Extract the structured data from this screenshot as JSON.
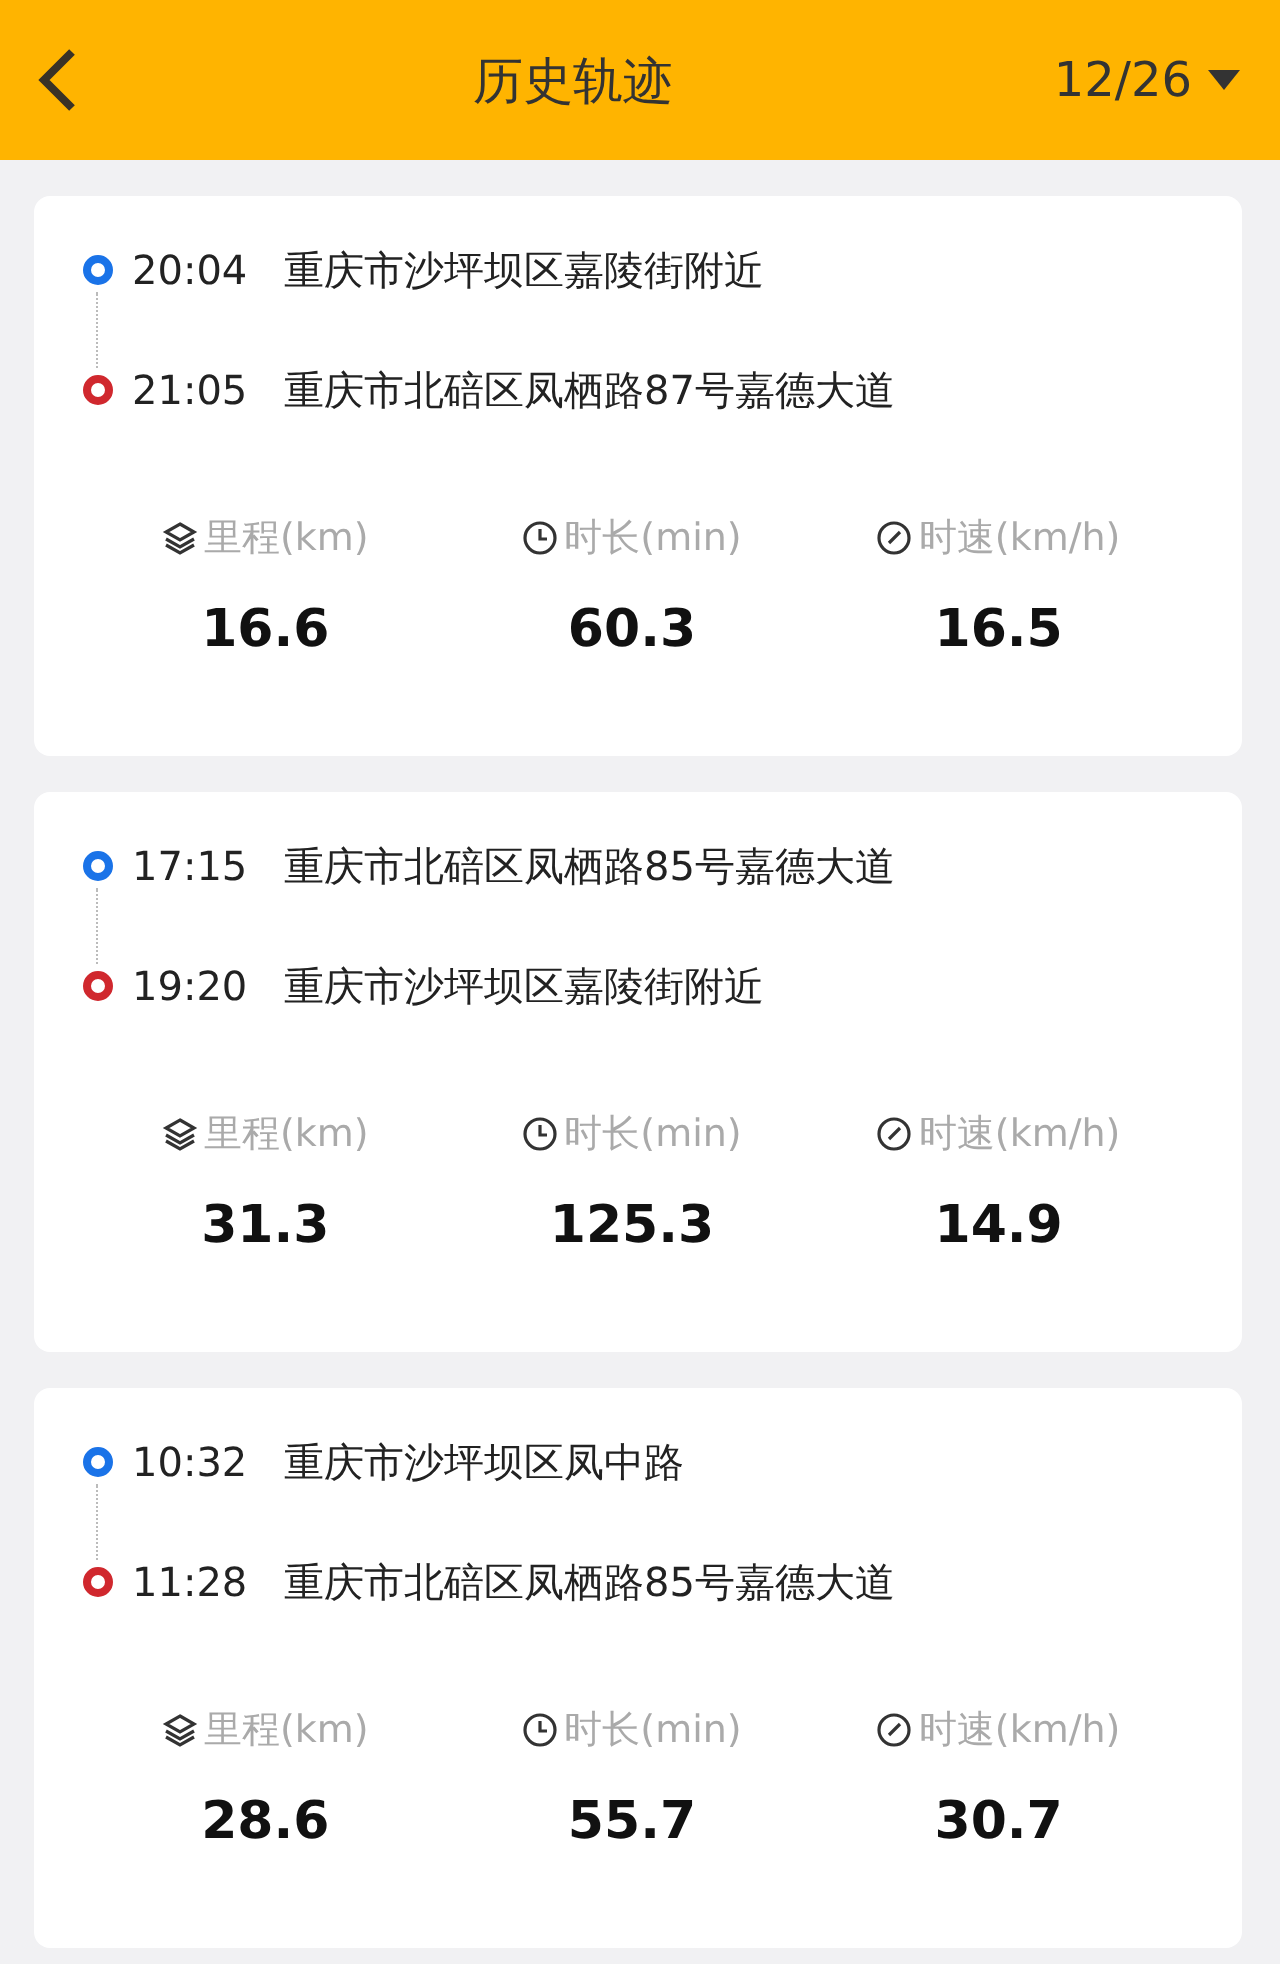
{
  "header": {
    "title": "历史轨迹",
    "date": "12/26"
  },
  "trips": [
    {
      "stops": [
        {
          "kind": "start",
          "time": "20:04",
          "address": "重庆市沙坪坝区嘉陵街附近"
        },
        {
          "kind": "end",
          "time": "21:05",
          "address": "重庆市北碚区凤栖路87号嘉德大道"
        }
      ],
      "metrics": [
        {
          "kind": "distance",
          "label": "里程(km)",
          "value": "16.6"
        },
        {
          "kind": "duration",
          "label": "时长(min)",
          "value": "60.3"
        },
        {
          "kind": "speed",
          "label": "时速(km/h)",
          "value": "16.5"
        }
      ]
    },
    {
      "stops": [
        {
          "kind": "start",
          "time": "17:15",
          "address": "重庆市北碚区凤栖路85号嘉德大道"
        },
        {
          "kind": "end",
          "time": "19:20",
          "address": "重庆市沙坪坝区嘉陵街附近"
        }
      ],
      "metrics": [
        {
          "kind": "distance",
          "label": "里程(km)",
          "value": "31.3"
        },
        {
          "kind": "duration",
          "label": "时长(min)",
          "value": "125.3"
        },
        {
          "kind": "speed",
          "label": "时速(km/h)",
          "value": "14.9"
        }
      ]
    },
    {
      "stops": [
        {
          "kind": "start",
          "time": "10:32",
          "address": "重庆市沙坪坝区凤中路"
        },
        {
          "kind": "end",
          "time": "11:28",
          "address": "重庆市北碚区凤栖路85号嘉德大道"
        }
      ],
      "metrics": [
        {
          "kind": "distance",
          "label": "里程(km)",
          "value": "28.6"
        },
        {
          "kind": "duration",
          "label": "时长(min)",
          "value": "55.7"
        },
        {
          "kind": "speed",
          "label": "时速(km/h)",
          "value": "30.7"
        }
      ]
    }
  ]
}
